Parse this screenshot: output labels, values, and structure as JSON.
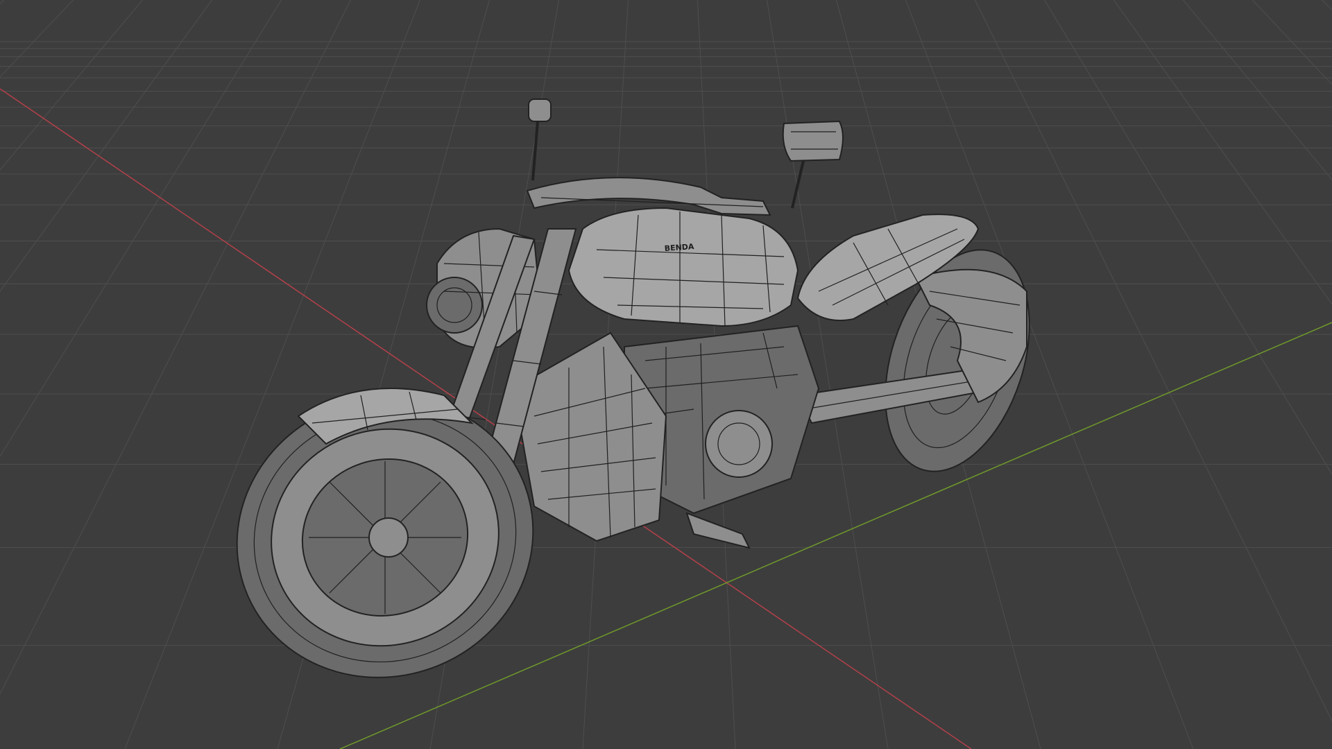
{
  "viewport": {
    "background": "#3d3d3d",
    "grid_color": "#4e4e4e",
    "x_axis_color": "#b5404a",
    "y_axis_color": "#6f9a2a",
    "shading_mode": "wireframe-overlay"
  },
  "model": {
    "tank_badge": "BENDA"
  }
}
